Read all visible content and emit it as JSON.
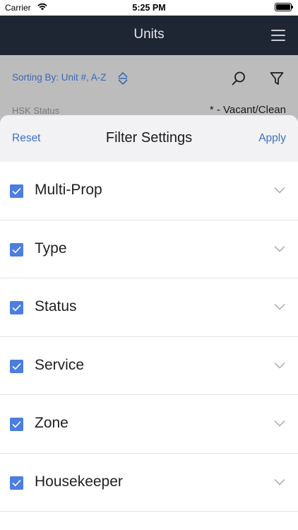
{
  "status_bar": {
    "carrier": "Carrier",
    "time": "5:25 PM",
    "wifi_icon": "wifi-icon",
    "battery_icon": "battery-icon"
  },
  "nav": {
    "title": "Units",
    "menu_icon": "hamburger-menu-icon"
  },
  "background": {
    "sort_label": "Sorting By: Unit #, A-Z",
    "hsk_label": "HSK Status",
    "hsk_value": "* - Vacant/Clean"
  },
  "sheet": {
    "reset_label": "Reset",
    "title": "Filter Settings",
    "apply_label": "Apply",
    "filters": [
      {
        "label": "Multi-Prop",
        "checked": true
      },
      {
        "label": "Type",
        "checked": true
      },
      {
        "label": "Status",
        "checked": true
      },
      {
        "label": "Service",
        "checked": true
      },
      {
        "label": "Zone",
        "checked": true
      },
      {
        "label": "Housekeeper",
        "checked": true
      }
    ]
  },
  "colors": {
    "nav_bg": "#1e2633",
    "accent": "#3d6fc7",
    "checkbox": "#4b7ee0",
    "dim_overlay": "#bcbcbc"
  }
}
